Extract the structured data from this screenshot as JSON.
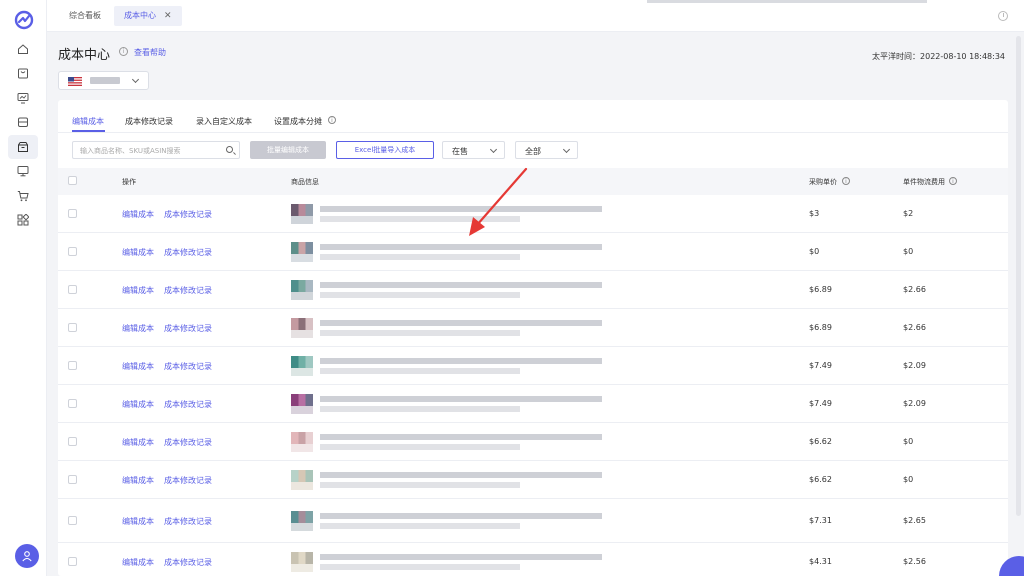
{
  "sidebar": {
    "icons": [
      "home-icon",
      "shop-bag-icon",
      "chart-icon",
      "store-icon",
      "box-icon",
      "monitor-icon",
      "cart-icon",
      "apps-icon"
    ],
    "user_icon": "user-icon"
  },
  "topbar": {
    "tabs": [
      {
        "label": "综合看板",
        "active": false
      },
      {
        "label": "成本中心",
        "active": true,
        "close": "✕"
      }
    ]
  },
  "header": {
    "title": "成本中心",
    "help_icon": "i",
    "help_link": "查看帮助",
    "server_time": "太平洋时间：2022-08-10 18:48:34"
  },
  "country_select": {
    "flag": "us-flag-icon"
  },
  "card": {
    "tabs": [
      {
        "label": "编辑成本",
        "active": true
      },
      {
        "label": "成本修改记录",
        "active": false
      },
      {
        "label": "录入自定义成本",
        "active": false
      },
      {
        "label": "设置成本分摊",
        "active": false
      }
    ],
    "search_placeholder": "输入商品名称、SKU或ASIN搜索",
    "batch_edit_label": "批量编辑成本",
    "excel_import_label": "Excel批量导入成本",
    "status_select": "在售",
    "scope_select": "全部"
  },
  "table": {
    "headers": {
      "action": "操作",
      "product": "商品信息",
      "unit_cost": "采购单价",
      "shipping": "单件物流费用"
    },
    "action_edit": "编辑成本",
    "action_log": "成本修改记录",
    "rows": [
      {
        "unit_cost": "$3",
        "shipping": "$2",
        "thumb": [
          "#6b5a6e",
          "#b88a9a",
          "#8f9aa8",
          "#cfd4da"
        ]
      },
      {
        "unit_cost": "$0",
        "shipping": "$0",
        "thumb": [
          "#5d8f8a",
          "#c9a3a6",
          "#7d8fa0",
          "#d8dde2"
        ]
      },
      {
        "unit_cost": "$6.89",
        "shipping": "$2.66",
        "thumb": [
          "#4f8f8c",
          "#7aa9a0",
          "#a9b8c2",
          "#d1d6da"
        ]
      },
      {
        "unit_cost": "$6.89",
        "shipping": "$2.66",
        "thumb": [
          "#c49aa0",
          "#8b6f78",
          "#d8c1c4",
          "#e6e1e2"
        ]
      },
      {
        "unit_cost": "$7.49",
        "shipping": "$2.09",
        "thumb": [
          "#3f8c86",
          "#6fb0a6",
          "#9fc8c2",
          "#dce6e4"
        ]
      },
      {
        "unit_cost": "$7.49",
        "shipping": "$2.09",
        "thumb": [
          "#8a3f7a",
          "#b86fa3",
          "#6f6f8c",
          "#d9d2dc"
        ]
      },
      {
        "unit_cost": "$6.62",
        "shipping": "$0",
        "thumb": [
          "#e2b6b9",
          "#c9a2a6",
          "#e8d0d2",
          "#f1e6e7"
        ]
      },
      {
        "unit_cost": "$6.62",
        "shipping": "$0",
        "thumb": [
          "#b7d2c8",
          "#d6c7b5",
          "#a9c4b8",
          "#ece7df"
        ]
      },
      {
        "unit_cost": "$7.31",
        "shipping": "$2.65",
        "thumb": [
          "#5a8e92",
          "#a58d9a",
          "#7da3a6",
          "#d5dadd"
        ]
      },
      {
        "unit_cost": "$4.31",
        "shipping": "$2.56",
        "thumb": [
          "#c9c3b2",
          "#e0d8c6",
          "#b8b5a8",
          "#eeebe3"
        ]
      }
    ]
  },
  "colors": {
    "accent": "#5a5fe6",
    "annotation": "#e53935"
  }
}
